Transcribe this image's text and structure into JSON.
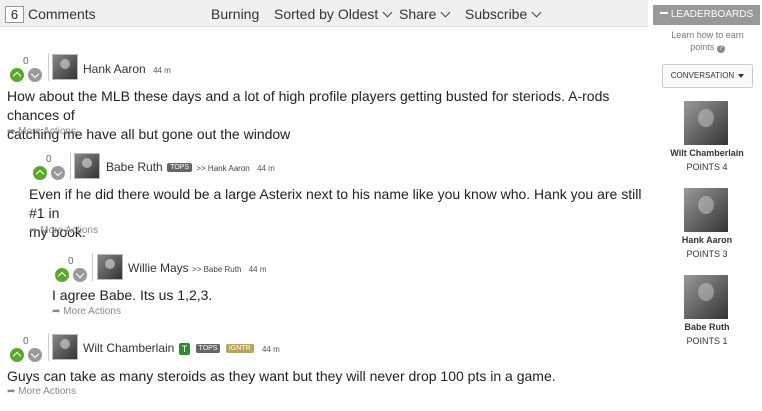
{
  "header": {
    "comment_count": "6",
    "comments_label": "Comments",
    "burning": "Burning",
    "sort": "Sorted by Oldest",
    "share": "Share",
    "subscribe": "Subscribe"
  },
  "comments": [
    {
      "score": "0",
      "author": "Hank Aaron",
      "ago": "44 m",
      "text_line1": "How about the MLB these days and a lot of high profile players getting busted for steriods. A-rods chances of",
      "text_line2": "catching me have all but gone out the window",
      "more": "More Actions"
    },
    {
      "score": "0",
      "author": "Babe Ruth",
      "badge": "TOPS",
      "reply_to": ">> Hank Aaron",
      "ago": "44 m",
      "text_line1": "Even if he did there would be a large Asterix next to his name like you know who. Hank you are still #1 in",
      "text_line2": "my book.",
      "more": "More Actions"
    },
    {
      "score": "0",
      "author": "Willie Mays",
      "reply_to": ">> Babe Ruth",
      "ago": "44 m",
      "text_line1": "I agree Babe. Its us 1,2,3.",
      "more": "More Actions"
    },
    {
      "score": "0",
      "author": "Wilt Chamberlain",
      "badge_t": "T",
      "badge": "TOPS",
      "badge2": "IGNTR",
      "ago": "44 m",
      "text_line1": "Guys can take as many steroids as they want but they will never drop 100 pts in a game.",
      "more": "More Actions"
    }
  ],
  "sidebar": {
    "leaderboards": "LEADERBOARDS",
    "learn_line1": "Learn how to earn",
    "learn_line2": "points",
    "conversation": "CONVERSATION",
    "leaders": [
      {
        "name": "Wilt Chamberlain",
        "points": "POINTS 4"
      },
      {
        "name": "Hank Aaron",
        "points": "POINTS 3"
      },
      {
        "name": "Babe Ruth",
        "points": "POINTS 1"
      }
    ]
  },
  "colors": {
    "upvote": "#5aa82b",
    "downvote": "#999999",
    "leaderboard_btn": "#999999"
  }
}
